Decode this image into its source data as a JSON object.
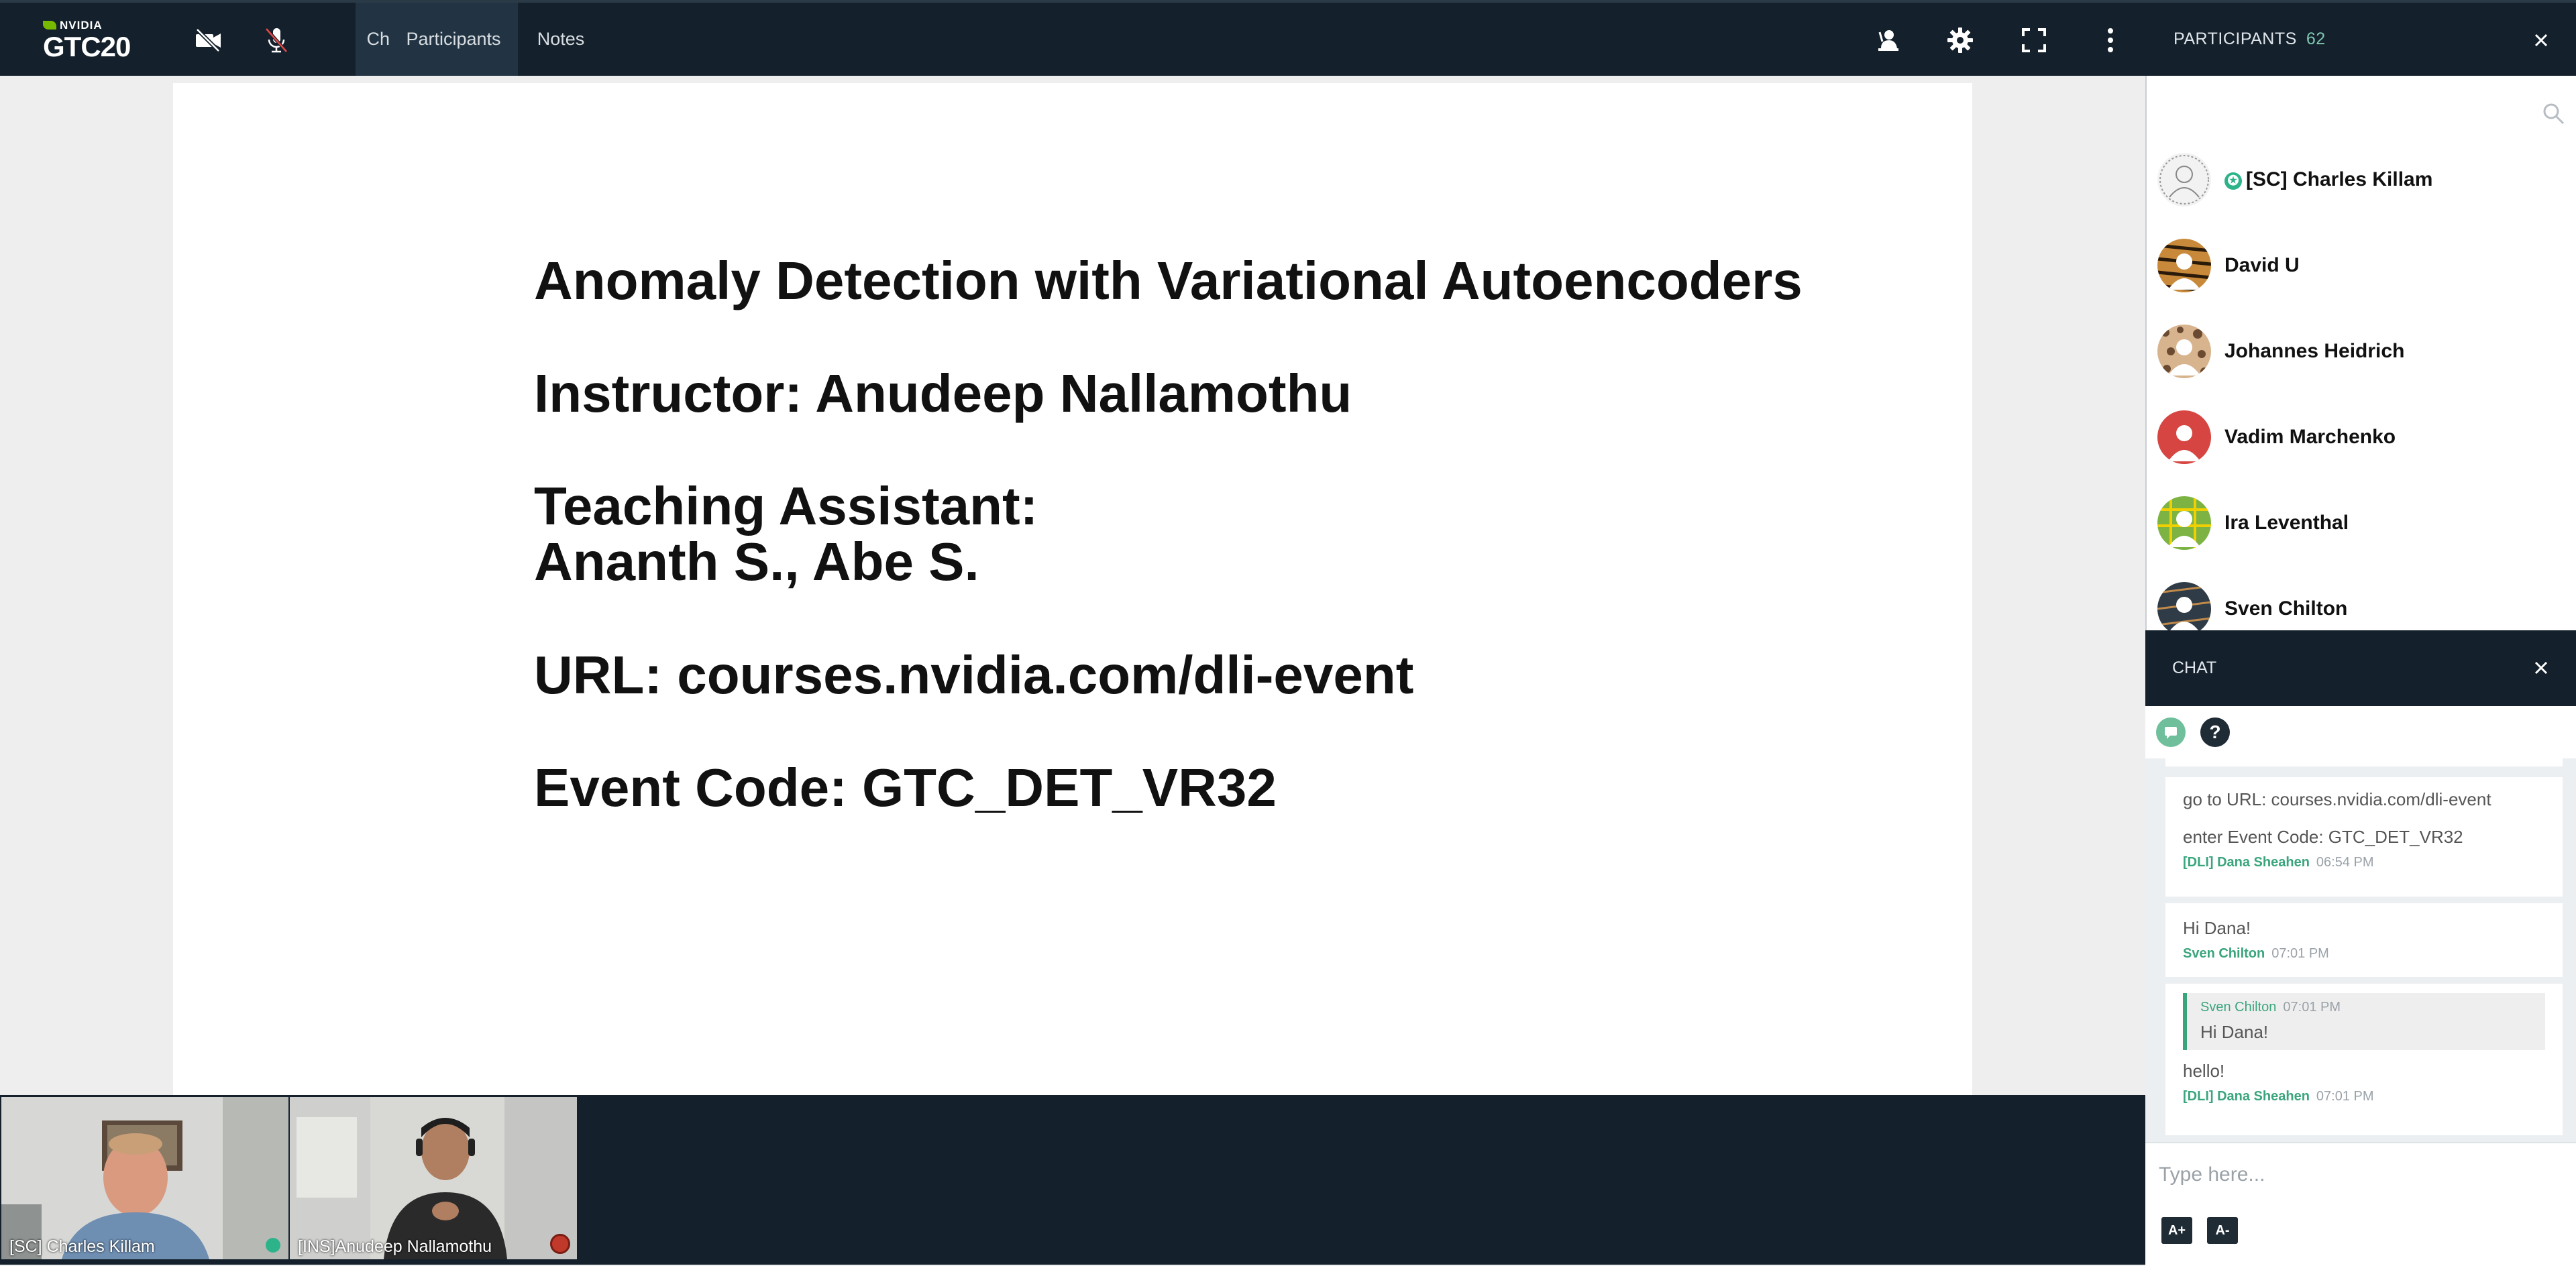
{
  "header": {
    "logo_brand": "NVIDIA",
    "logo_event": "GTC20",
    "tabs": [
      {
        "label": "Chat",
        "active": true
      },
      {
        "label": "Participants",
        "active": true
      },
      {
        "label": "Notes",
        "active": false
      }
    ],
    "icons": [
      "camera-off-icon",
      "mic-off-icon",
      "raise-hand-icon",
      "gear-icon",
      "fullscreen-icon",
      "more-vertical-icon"
    ]
  },
  "slide": {
    "lines": [
      "Anomaly Detection with Variational Autoencoders",
      "Instructor: Anudeep Nallamothu",
      "Teaching Assistant:",
      "Ananth S., Abe S.",
      "URL: courses.nvidia.com/dli-event",
      "Event Code: GTC_DET_VR32"
    ]
  },
  "videos": [
    {
      "name": "[SC] Charles Killam",
      "status": "green"
    },
    {
      "name": "[INS]Anudeep Nallamothu",
      "status": "red"
    }
  ],
  "participants": {
    "title": "PARTICIPANTS",
    "count": "62",
    "list": [
      {
        "name": "[SC] Charles Killam",
        "moderator": true
      },
      {
        "name": "David U",
        "moderator": false
      },
      {
        "name": "Johannes Heidrich",
        "moderator": false
      },
      {
        "name": "Vadim Marchenko",
        "moderator": false
      },
      {
        "name": "Ira Leventhal",
        "moderator": false
      },
      {
        "name": "Sven Chilton",
        "moderator": false
      }
    ]
  },
  "chat": {
    "title": "CHAT",
    "tools": {
      "help": "?"
    },
    "messages": [
      {
        "lines": [
          "go to URL: courses.nvidia.com/dli-event",
          "enter Event Code: GTC_DET_VR32"
        ],
        "author": "[DLI] Dana Sheahen",
        "time": "06:54 PM"
      },
      {
        "lines": [
          "Hi Dana!"
        ],
        "author": "Sven Chilton",
        "time": "07:01 PM"
      },
      {
        "quote": {
          "author": "Sven Chilton",
          "time": "07:01 PM",
          "text": "Hi Dana!"
        },
        "lines": [
          "hello!"
        ],
        "author": "[DLI] Dana Sheahen",
        "time": "07:01 PM"
      }
    ],
    "composer": {
      "placeholder": "Type here...",
      "font_up": "A+",
      "font_down": "A-"
    }
  },
  "colors": {
    "bar": "#14212c",
    "accent": "#3aa57d",
    "brand": "#76b900"
  }
}
